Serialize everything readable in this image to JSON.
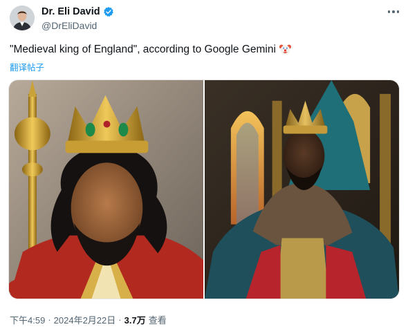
{
  "author": {
    "display_name": "Dr. Eli David",
    "handle": "@DrEliDavid",
    "verified_color": "#1d9bf0"
  },
  "tweet": {
    "text": "\"Medieval king of England\", according to Google Gemini",
    "emoji": "clown-face",
    "translate_label": "翻译帖子"
  },
  "media": {
    "images": [
      {
        "subject": "crowned-king-with-golden-scepter"
      },
      {
        "subject": "crowned-king-on-throne-with-fur-mantle"
      }
    ]
  },
  "meta": {
    "time": "下午4:59",
    "date": "2024年2月22日",
    "separator": "·",
    "views_count": "3.7万",
    "views_label": "查看"
  },
  "colors": {
    "text": "#0f1419",
    "secondary": "#536471",
    "link": "#1d9bf0"
  }
}
